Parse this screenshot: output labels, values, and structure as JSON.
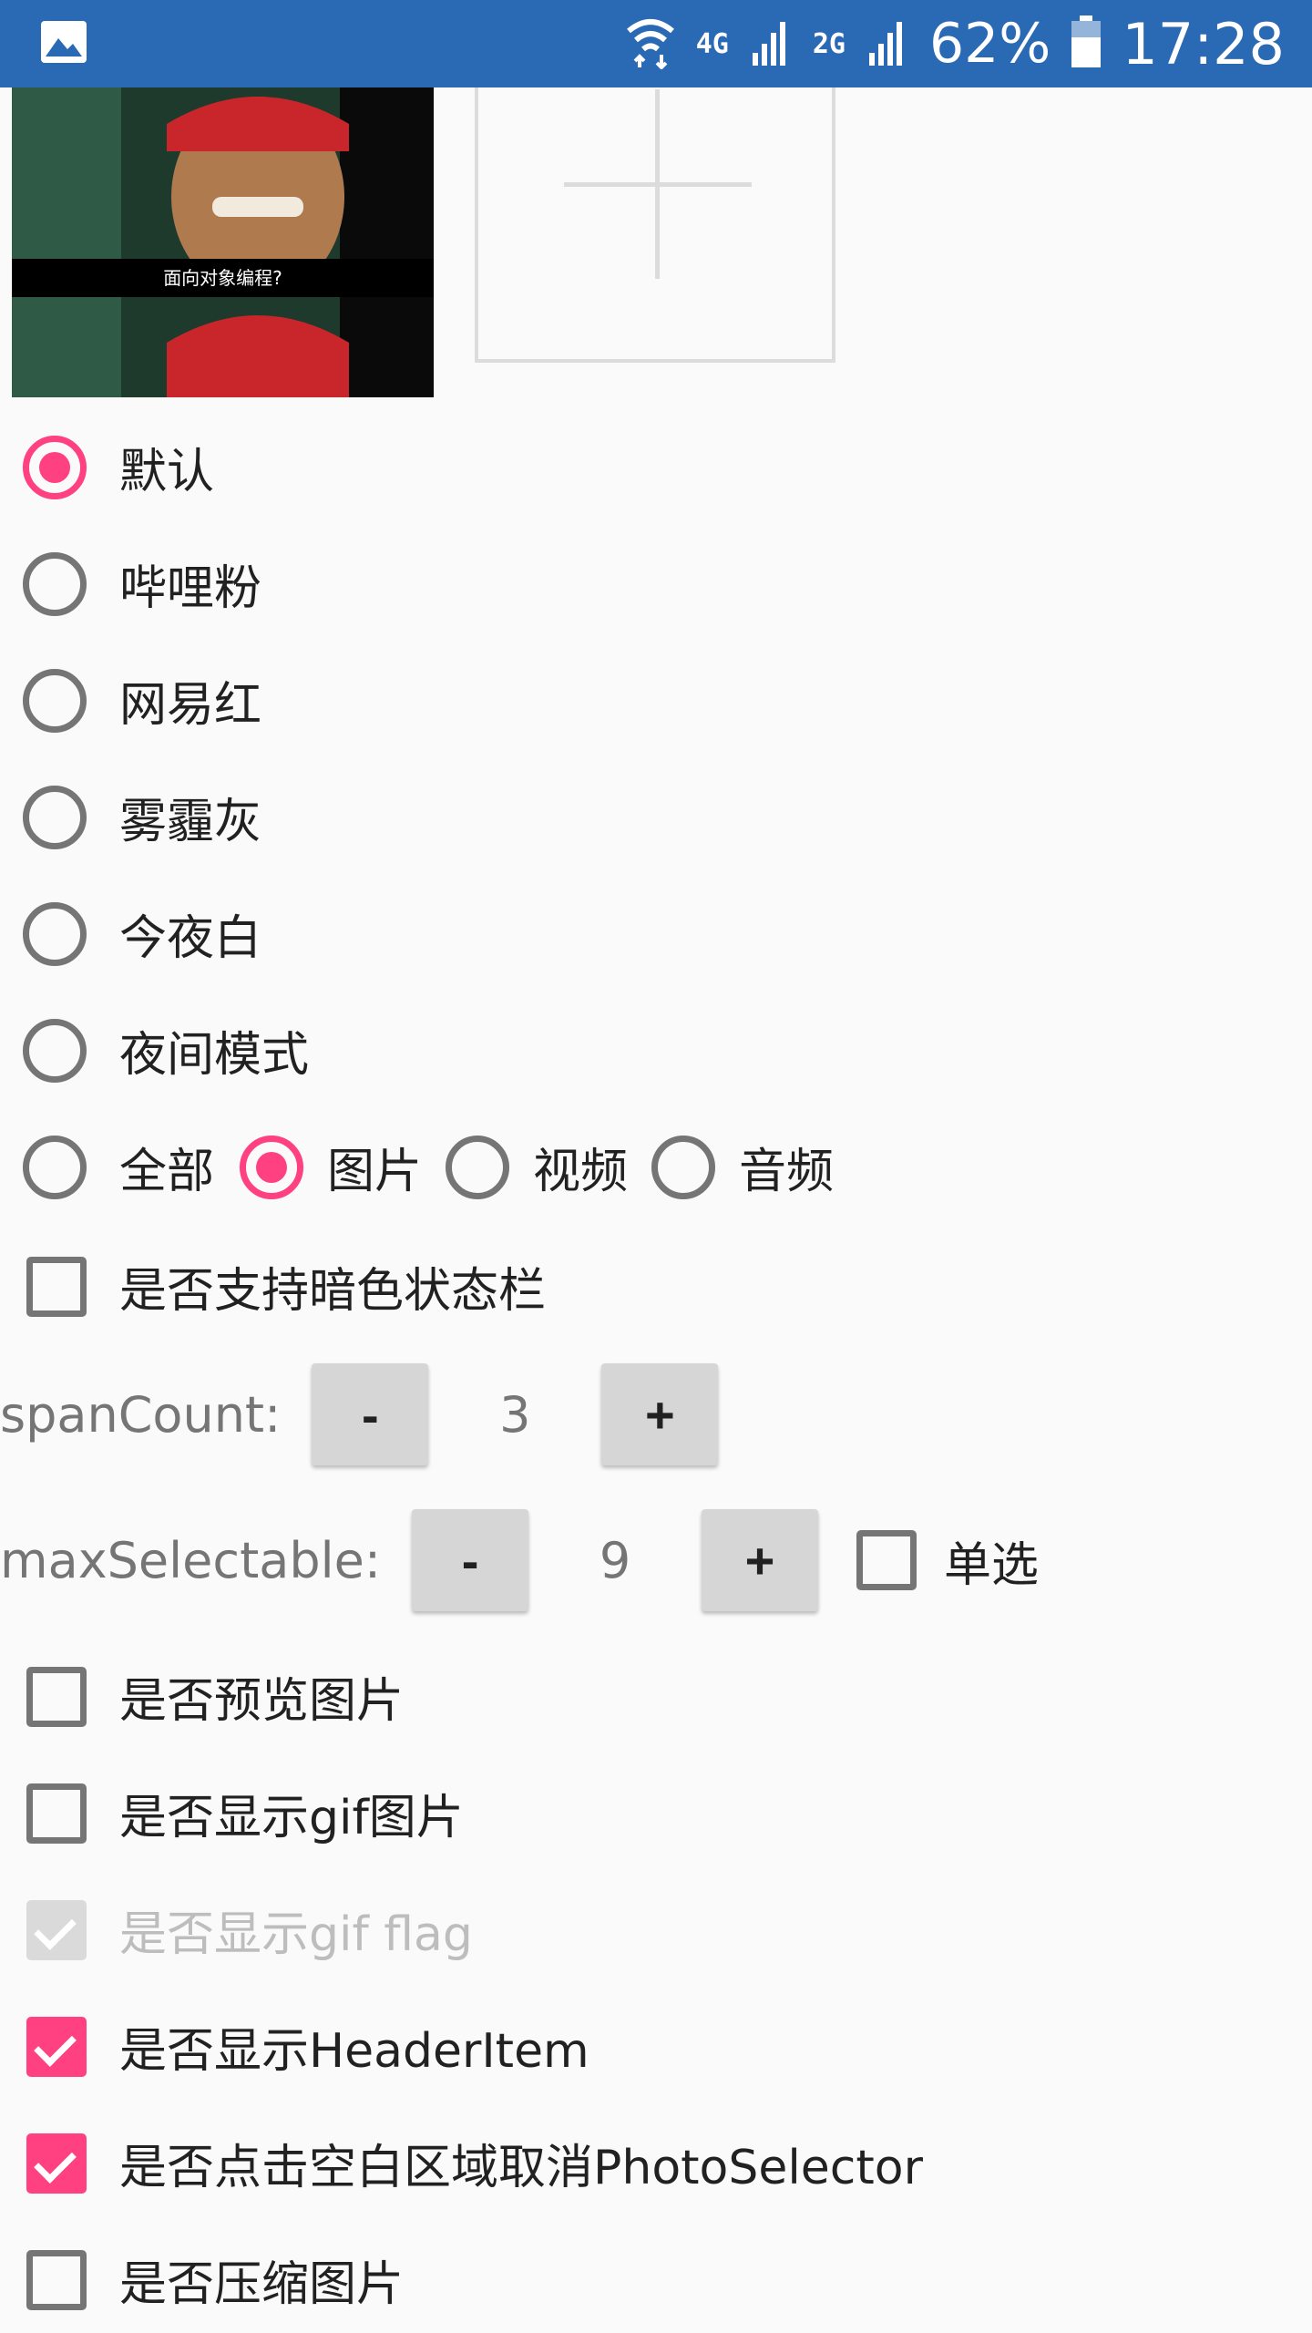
{
  "status_bar": {
    "network_4g": "4G",
    "network_2g": "2G",
    "battery_percent": "62%",
    "time": "17:28",
    "icons": [
      "image-icon",
      "wifi-icon",
      "signal-icon",
      "signal-icon",
      "battery-icon"
    ]
  },
  "thumbnail": {
    "caption": "面向对象编程?"
  },
  "themes": {
    "options": [
      "默认",
      "哔哩粉",
      "网易红",
      "雾霾灰",
      "今夜白",
      "夜间模式"
    ],
    "selected": 0
  },
  "media_types": {
    "options": [
      "全部",
      "图片",
      "视频",
      "音频"
    ],
    "selected": 1
  },
  "dark_status_bar": {
    "label": "是否支持暗色状态栏",
    "checked": false
  },
  "span_count": {
    "label": "spanCount:",
    "minus": "-",
    "plus": "+",
    "value": "3"
  },
  "max_selectable": {
    "label": "maxSelectable:",
    "minus": "-",
    "plus": "+",
    "value": "9",
    "single_label": "单选",
    "single_checked": false
  },
  "options": [
    {
      "label": "是否预览图片",
      "checked": false,
      "disabled": false
    },
    {
      "label": "是否显示gif图片",
      "checked": false,
      "disabled": false
    },
    {
      "label": "是否显示gif flag",
      "checked": true,
      "disabled": true
    },
    {
      "label": "是否显示HeaderItem",
      "checked": true,
      "disabled": false
    },
    {
      "label": "是否点击空白区域取消PhotoSelector",
      "checked": true,
      "disabled": false
    },
    {
      "label": "是否压缩图片",
      "checked": false,
      "disabled": false
    }
  ],
  "colors": {
    "accent": "#ff4081",
    "status_bar": "#2a69b4"
  }
}
